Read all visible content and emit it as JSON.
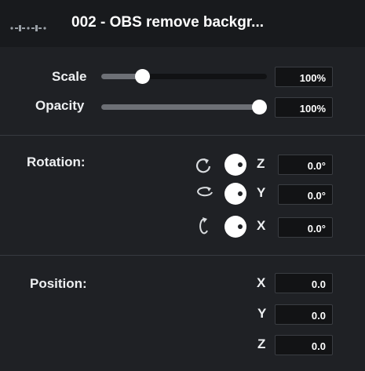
{
  "header": {
    "title": "002 - OBS remove backgr...",
    "icon": "audio-waveform-icon"
  },
  "scale": {
    "label": "Scale",
    "value": "100%",
    "level": 0.25
  },
  "opacity": {
    "label": "Opacity",
    "value": "100%",
    "level": 1.0
  },
  "rotation": {
    "label": "Rotation:",
    "z": {
      "axis": "Z",
      "value": "0.0°",
      "icon": "rotate-z-icon"
    },
    "y": {
      "axis": "Y",
      "value": "0.0°",
      "icon": "rotate-y-icon"
    },
    "x": {
      "axis": "X",
      "value": "0.0°",
      "icon": "rotate-x-icon"
    }
  },
  "position": {
    "label": "Position:",
    "x": {
      "axis": "X",
      "value": "0.0"
    },
    "y": {
      "axis": "Y",
      "value": "0.0"
    },
    "z": {
      "axis": "Z",
      "value": "0.0"
    }
  },
  "colors": {
    "background": "#1f2125",
    "header": "#181a1d",
    "field": "#121315",
    "thumb": "#ffffff"
  }
}
